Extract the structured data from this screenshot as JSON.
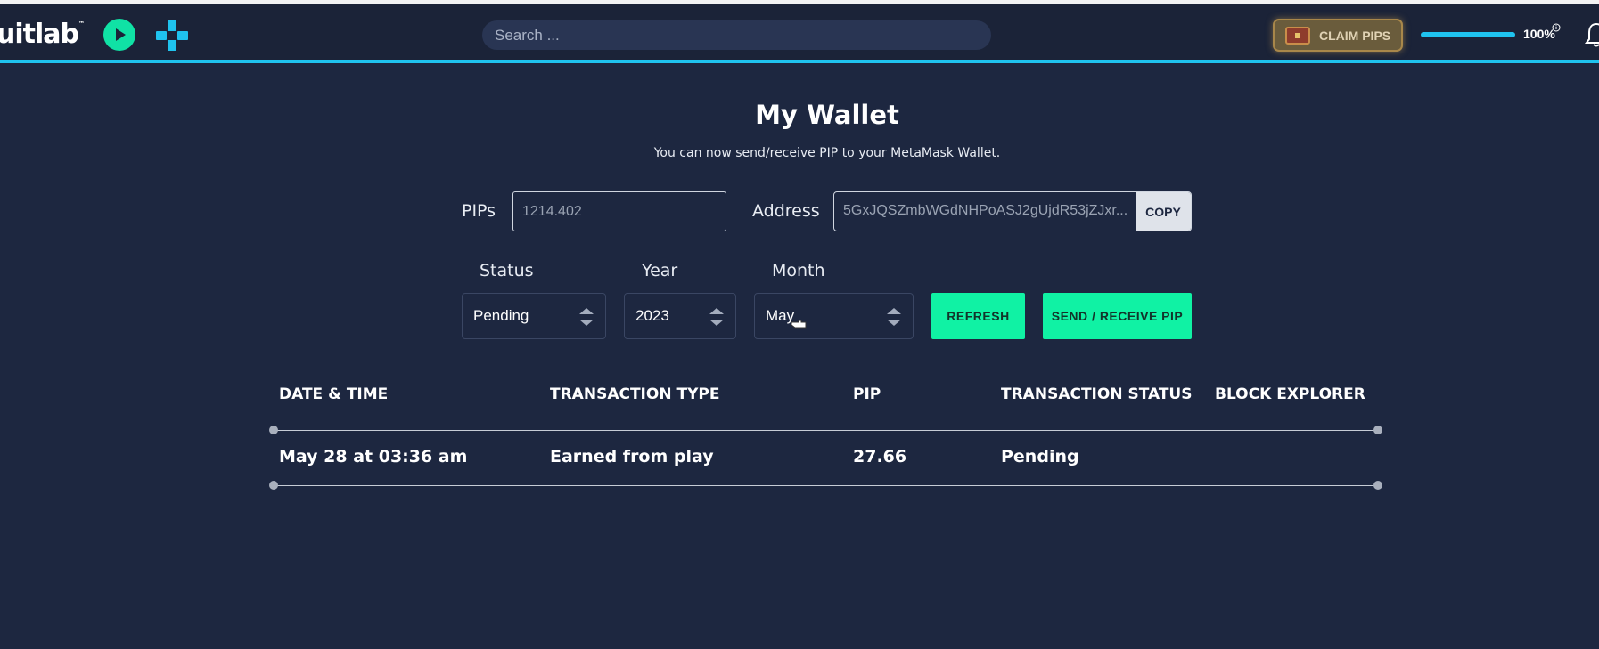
{
  "header": {
    "logo_text": "uitlab",
    "logo_tm": "™",
    "play_icon": "play-circle-icon",
    "game_icon": "gamepad-icon",
    "search_placeholder": "Search ...",
    "claim_label": "CLAIM PIPS",
    "claim_icon": "treasure-chest-icon",
    "progress_percent": 100,
    "progress_label": "100%",
    "info_icon": "info-icon",
    "bell_icon": "bell-icon"
  },
  "main": {
    "title": "My Wallet",
    "subtitle": "You can now send/receive PIP to your MetaMask Wallet.",
    "pips_label": "PIPs",
    "pips_value": "1214.402",
    "address_label": "Address",
    "address_value": "5GxJQSZmbWGdNHPoASJ2gUjdR53jZJxr...",
    "copy_label": "COPY",
    "status_label": "Status",
    "status_value": "Pending",
    "year_label": "Year",
    "year_value": "2023",
    "month_label": "Month",
    "month_value": "May",
    "refresh_label": "REFRESH",
    "send_receive_label": "SEND / RECEIVE PIP"
  },
  "table": {
    "headers": [
      "DATE & TIME",
      "TRANSACTION TYPE",
      "PIP",
      "TRANSACTION STATUS",
      "BLOCK EXPLORER"
    ],
    "rows": [
      [
        "May 28 at 03:36 am",
        "Earned from play",
        "27.66",
        "Pending",
        ""
      ]
    ]
  },
  "colors": {
    "background": "#1d2740",
    "accent_green": "#10f2a4",
    "accent_blue": "#1fc3ef"
  }
}
